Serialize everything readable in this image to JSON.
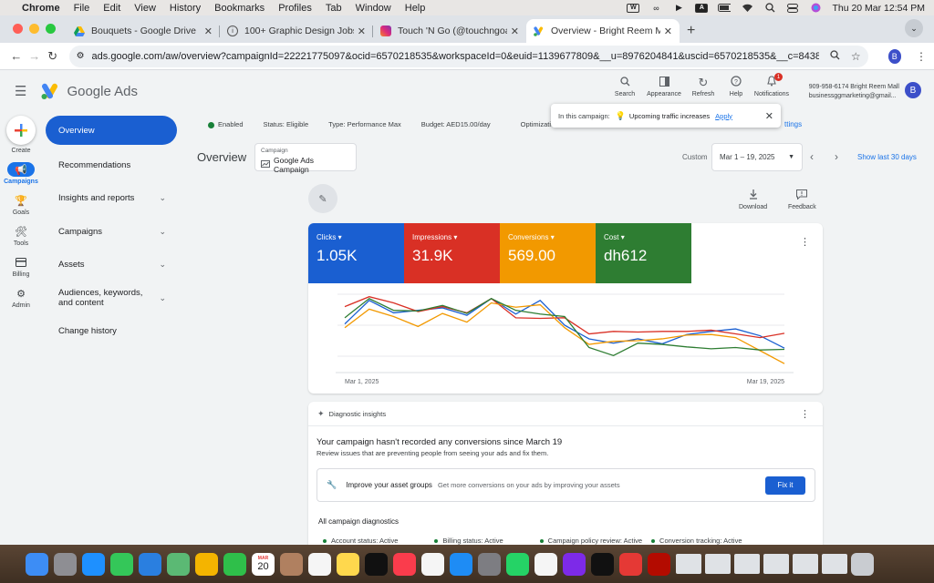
{
  "menubar": {
    "app": "Chrome",
    "menus": [
      "File",
      "Edit",
      "View",
      "History",
      "Bookmarks",
      "Profiles",
      "Tab",
      "Window",
      "Help"
    ],
    "datetime": "Thu 20 Mar  12:54 PM",
    "status_icons": [
      "wps-icon",
      "creative-cloud-icon",
      "play-icon",
      "a-icon",
      "battery-icon",
      "wifi-icon",
      "search-icon",
      "control-center-icon",
      "siri-icon"
    ]
  },
  "browser": {
    "tabs": [
      {
        "title": "Bouquets - Google Drive",
        "icon": "google-drive-icon"
      },
      {
        "title": "100+ Graphic Design Jobs, Em",
        "icon": "info-icon"
      },
      {
        "title": "Touch 'N Go (@touchngoad)",
        "icon": "instagram-icon"
      },
      {
        "title": "Overview - Bright Reem Mall",
        "icon": "google-ads-icon",
        "active": true
      }
    ],
    "url": "ads.google.com/aw/overview?campaignId=22221775097&ocid=6570218535&workspaceId=0&euid=1139677809&__u=8976204841&uscid=6570218535&__c=843871...",
    "profile_initial": "B"
  },
  "header": {
    "product": "Google Ads",
    "actions": [
      {
        "label": "Search",
        "icon": "search-icon"
      },
      {
        "label": "Appearance",
        "icon": "appearance-icon"
      },
      {
        "label": "Refresh",
        "icon": "refresh-icon"
      },
      {
        "label": "Help",
        "icon": "help-icon"
      },
      {
        "label": "Notifications",
        "icon": "bell-icon",
        "badge": "1"
      }
    ],
    "account_line1": "909-958-6174 Bright Reem Mall",
    "account_line2": "businessggmarketing@gmail...",
    "avatar_initial": "B"
  },
  "rail": {
    "create": "Create",
    "items": [
      {
        "label": "Campaigns",
        "icon": "campaigns-icon",
        "active": true
      },
      {
        "label": "Goals",
        "icon": "trophy-icon"
      },
      {
        "label": "Tools",
        "icon": "tools-icon"
      },
      {
        "label": "Billing",
        "icon": "billing-icon"
      },
      {
        "label": "Admin",
        "icon": "gear-icon"
      }
    ]
  },
  "sidenav": {
    "items": [
      {
        "label": "Overview",
        "active": true,
        "expandable": false
      },
      {
        "label": "Recommendations",
        "expandable": false
      },
      {
        "label": "Insights and reports",
        "expandable": true
      },
      {
        "label": "Campaigns",
        "expandable": true
      },
      {
        "label": "Assets",
        "expandable": true
      },
      {
        "label": "Audiences, keywords, and content",
        "expandable": true
      },
      {
        "label": "Change history",
        "expandable": false
      }
    ]
  },
  "status": {
    "enabled": "Enabled",
    "status": "Status: Eligible",
    "type": "Type: Performance Max",
    "budget": "Budget: AED15.00/day",
    "optimization": "Optimization sc",
    "settings_tail": "ttings"
  },
  "tooltip": {
    "prefix": "In this campaign:",
    "text": "Upcoming traffic increases",
    "action": "Apply"
  },
  "overview": {
    "title": "Overview",
    "campaign_label": "Campaign",
    "campaign_value": "Google Ads Campaign",
    "custom": "Custom",
    "date_range": "Mar 1 – 19, 2025",
    "show_last": "Show last 30 days",
    "download": "Download",
    "feedback": "Feedback"
  },
  "metrics": [
    {
      "name": "Clicks",
      "value": "1.05K",
      "color": "#1a5fd1"
    },
    {
      "name": "Impressions",
      "value": "31.9K",
      "color": "#d93025"
    },
    {
      "name": "Conversions",
      "value": "569.00",
      "color": "#f29900"
    },
    {
      "name": "Cost",
      "value": "dh612",
      "color": "#2e7d32"
    }
  ],
  "chart_data": {
    "type": "line",
    "x": [
      "Mar 1",
      "Mar 2",
      "Mar 3",
      "Mar 4",
      "Mar 5",
      "Mar 6",
      "Mar 7",
      "Mar 8",
      "Mar 9",
      "Mar 10",
      "Mar 11",
      "Mar 12",
      "Mar 13",
      "Mar 14",
      "Mar 15",
      "Mar 16",
      "Mar 17",
      "Mar 18",
      "Mar 19"
    ],
    "tick_labels": [
      "Mar 1, 2025",
      "Mar 19, 2025"
    ],
    "ylim": [
      0,
      1
    ],
    "grid": true,
    "series": [
      {
        "name": "Clicks",
        "color": "#1a5fd1",
        "values": [
          0.52,
          0.9,
          0.7,
          0.74,
          0.78,
          0.66,
          0.93,
          0.68,
          0.9,
          0.5,
          0.28,
          0.21,
          0.28,
          0.2,
          0.35,
          0.4,
          0.44,
          0.33,
          0.13
        ]
      },
      {
        "name": "Impressions",
        "color": "#d93025",
        "values": [
          0.8,
          0.96,
          0.86,
          0.72,
          0.8,
          0.7,
          0.93,
          0.62,
          0.61,
          0.62,
          0.36,
          0.4,
          0.39,
          0.4,
          0.4,
          0.42,
          0.36,
          0.3,
          0.37
        ]
      },
      {
        "name": "Conversions",
        "color": "#f29900",
        "values": [
          0.46,
          0.76,
          0.64,
          0.48,
          0.69,
          0.55,
          0.86,
          0.79,
          0.83,
          0.46,
          0.19,
          0.24,
          0.25,
          0.28,
          0.34,
          0.35,
          0.3,
          0.09,
          -0.12
        ]
      },
      {
        "name": "Cost",
        "color": "#2e7d32",
        "values": [
          0.62,
          0.93,
          0.74,
          0.73,
          0.82,
          0.69,
          0.93,
          0.74,
          0.68,
          0.64,
          0.14,
          0.01,
          0.21,
          0.19,
          0.15,
          0.12,
          0.14,
          0.1,
          0.11
        ]
      }
    ]
  },
  "diagnostics": {
    "header": "Diagnostic insights",
    "title": "Your campaign hasn't recorded any conversions since March 19",
    "subtitle": "Review issues that are preventing people from seeing your ads and fix them.",
    "improve_title": "Improve your asset groups",
    "improve_text": "Get more conversions on your ads by improving your assets",
    "fix_label": "Fix it",
    "all_title": "All campaign diagnostics",
    "items": [
      "Account status: Active",
      "Billing status: Active",
      "Campaign policy review: Active",
      "Conversion tracking: Active"
    ]
  },
  "dock": {
    "apps": [
      {
        "name": "finder",
        "color": "#3d8df5"
      },
      {
        "name": "launchpad",
        "color": "#8e8e93"
      },
      {
        "name": "safari",
        "color": "#1e90ff"
      },
      {
        "name": "messages",
        "color": "#34c759"
      },
      {
        "name": "mail",
        "color": "#2a7fe0"
      },
      {
        "name": "maps",
        "color": "#5bb974"
      },
      {
        "name": "photos",
        "color": "#f4b400"
      },
      {
        "name": "facetime",
        "color": "#2fbf4a"
      },
      {
        "name": "calendar",
        "color": "#ffffff"
      },
      {
        "name": "contacts",
        "color": "#b08060"
      },
      {
        "name": "reminders",
        "color": "#f5f5f5"
      },
      {
        "name": "notes",
        "color": "#ffd84d"
      },
      {
        "name": "tv",
        "color": "#111111"
      },
      {
        "name": "music",
        "color": "#fa3c4c"
      },
      {
        "name": "freeform",
        "color": "#f5f5f5"
      },
      {
        "name": "app-store",
        "color": "#1e8cf5"
      },
      {
        "name": "settings",
        "color": "#7d7d82"
      },
      {
        "name": "whatsapp",
        "color": "#25d366"
      },
      {
        "name": "chrome",
        "color": "#f5f5f5"
      },
      {
        "name": "canva",
        "color": "#7d2ae8"
      },
      {
        "name": "capcut",
        "color": "#111111"
      },
      {
        "name": "wps",
        "color": "#e53935"
      },
      {
        "name": "acrobat",
        "color": "#b30b00"
      }
    ],
    "calendar_month": "MAR",
    "calendar_day": "20"
  }
}
